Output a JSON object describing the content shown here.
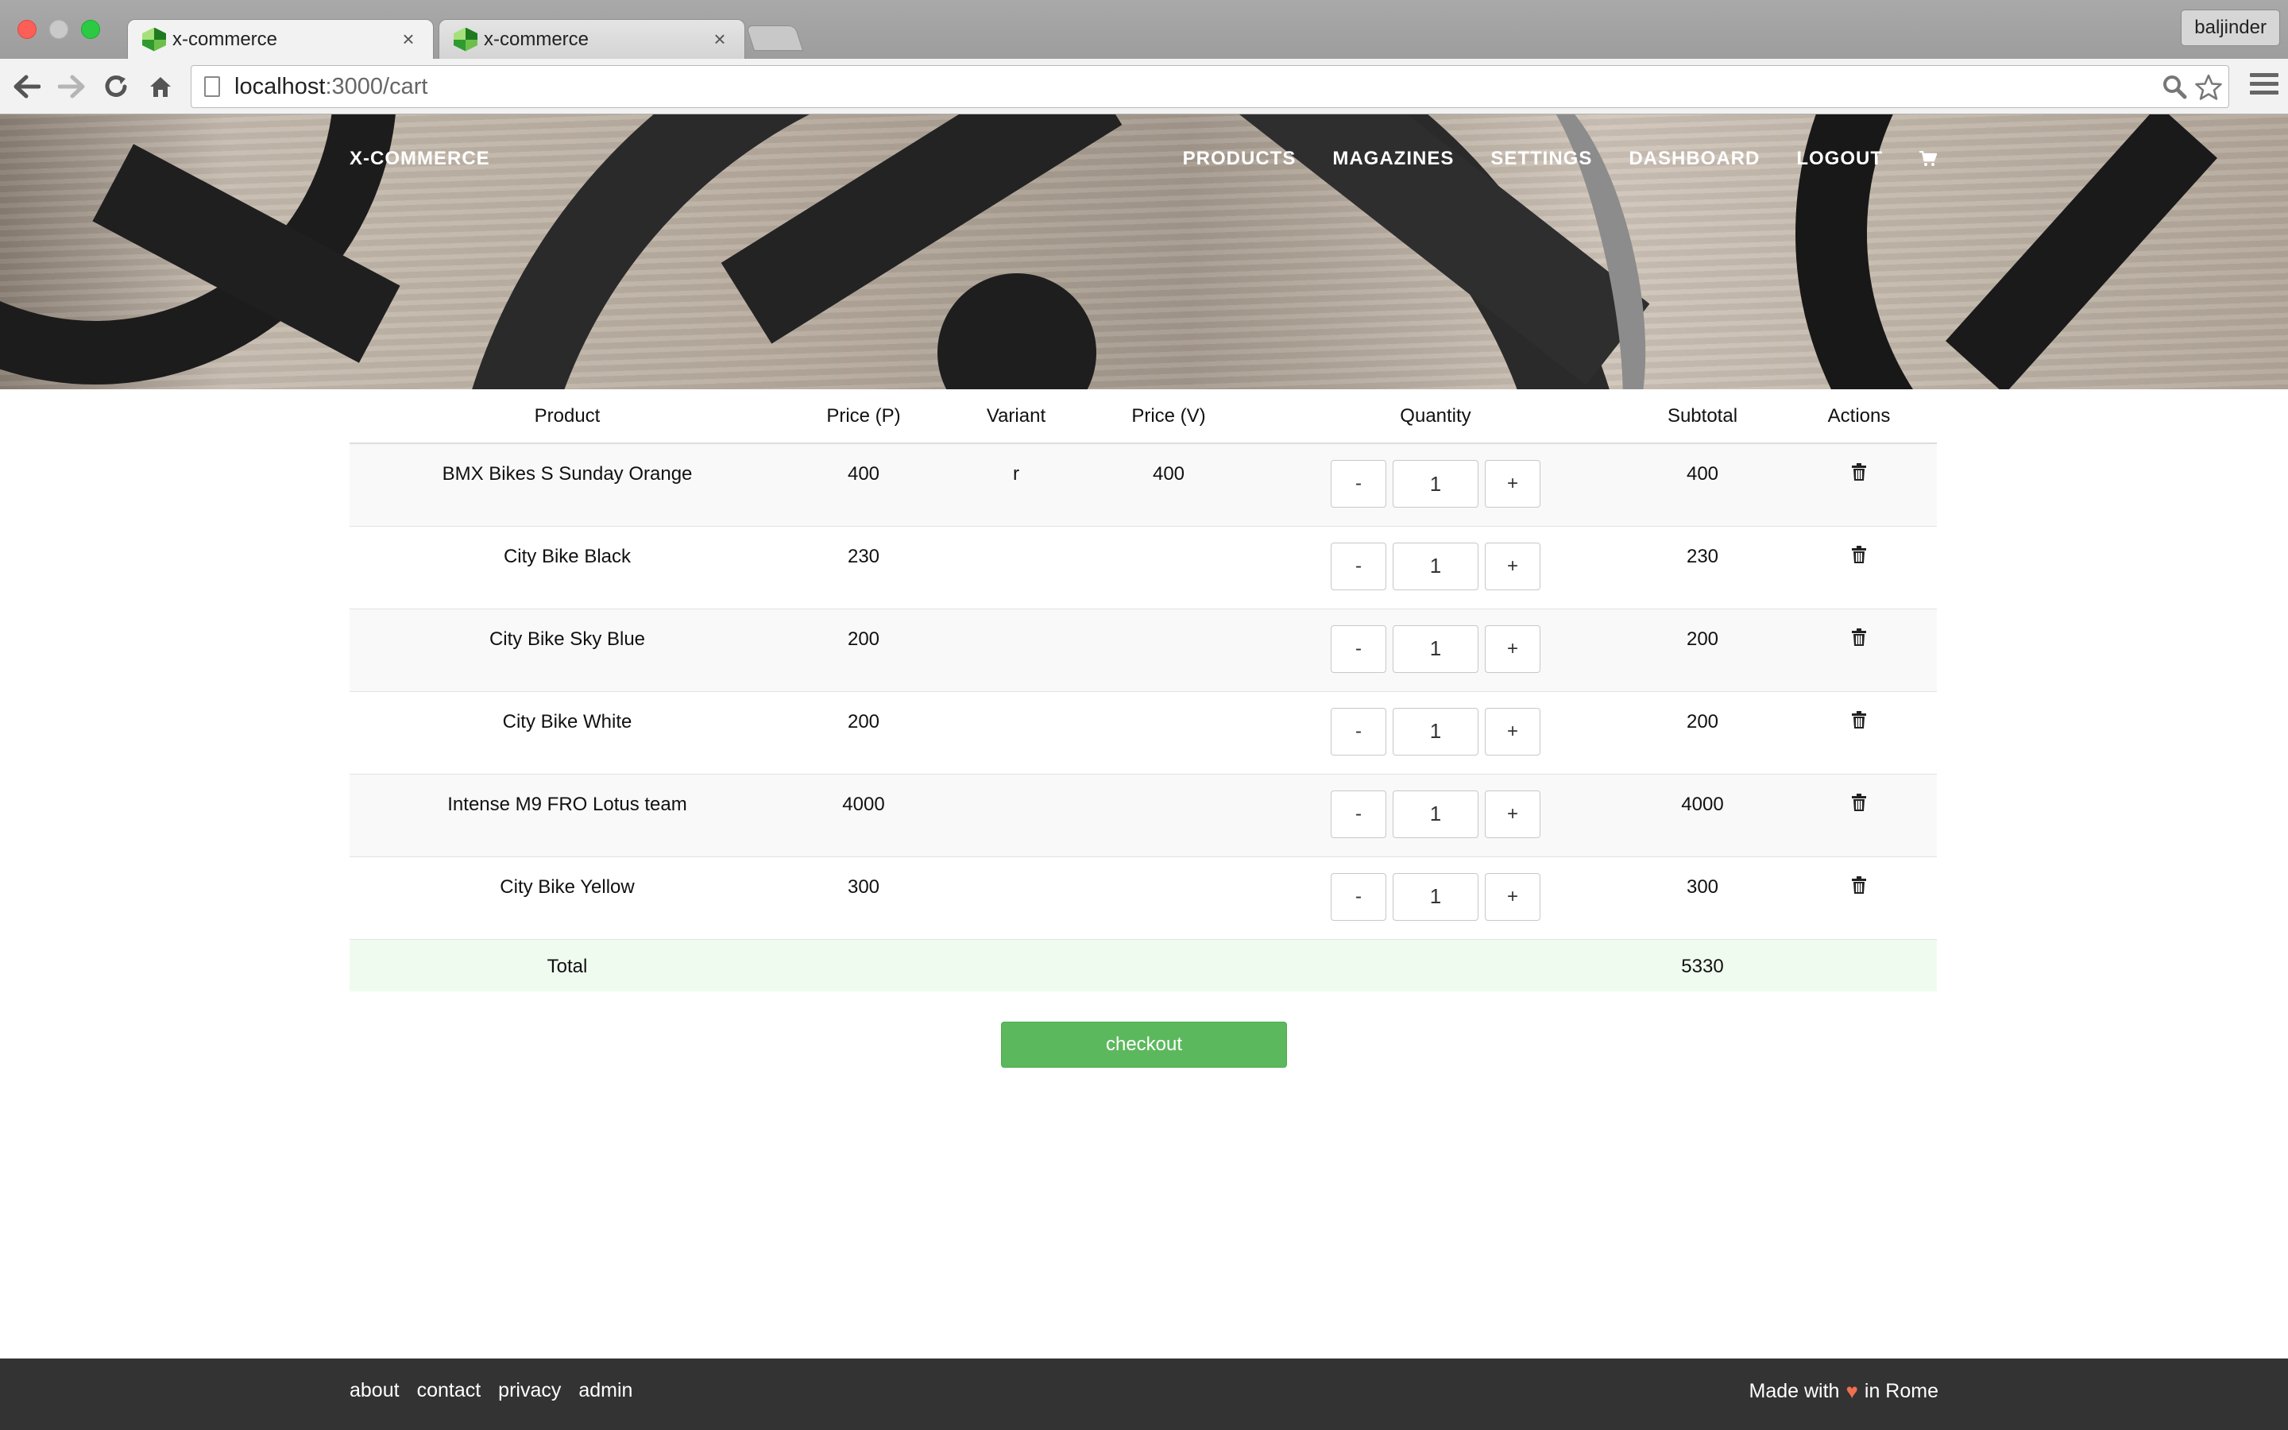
{
  "browser": {
    "tabs": [
      {
        "title": "x-commerce",
        "close": "×",
        "active": true
      },
      {
        "title": "x-commerce",
        "close": "×",
        "active": false
      }
    ],
    "profile": "baljinder",
    "url_host": "localhost",
    "url_path": ":3000/cart"
  },
  "site": {
    "brand": "X-COMMERCE",
    "nav": [
      "PRODUCTS",
      "MAGAZINES",
      "SETTINGS",
      "DASHBOARD",
      "LOGOUT"
    ]
  },
  "cart": {
    "headers": [
      "Product",
      "Price (P)",
      "Variant",
      "Price (V)",
      "Quantity",
      "Subtotal",
      "Actions"
    ],
    "items": [
      {
        "product": "BMX Bikes S Sunday Orange",
        "price_p": "400",
        "variant": "r",
        "price_v": "400",
        "quantity": "1",
        "subtotal": "400"
      },
      {
        "product": "City Bike Black",
        "price_p": "230",
        "variant": "",
        "price_v": "",
        "quantity": "1",
        "subtotal": "230"
      },
      {
        "product": "City Bike Sky Blue",
        "price_p": "200",
        "variant": "",
        "price_v": "",
        "quantity": "1",
        "subtotal": "200"
      },
      {
        "product": "City Bike White",
        "price_p": "200",
        "variant": "",
        "price_v": "",
        "quantity": "1",
        "subtotal": "200"
      },
      {
        "product": "Intense M9 FRO Lotus team",
        "price_p": "4000",
        "variant": "",
        "price_v": "",
        "quantity": "1",
        "subtotal": "4000"
      },
      {
        "product": "City Bike Yellow",
        "price_p": "300",
        "variant": "",
        "price_v": "",
        "quantity": "1",
        "subtotal": "300"
      }
    ],
    "minus_label": "-",
    "plus_label": "+",
    "total_label": "Total",
    "total_value": "5330",
    "checkout_label": "checkout"
  },
  "footer": {
    "links": [
      "about",
      "contact",
      "privacy",
      "admin"
    ],
    "made_with_prefix": "Made with",
    "made_with_suffix": "in Rome",
    "heart": "♥"
  },
  "colors": {
    "checkout": "#5cb85c",
    "total_row": "#f0fbf0",
    "footer_bg": "#333333",
    "heart": "#f0704e"
  }
}
